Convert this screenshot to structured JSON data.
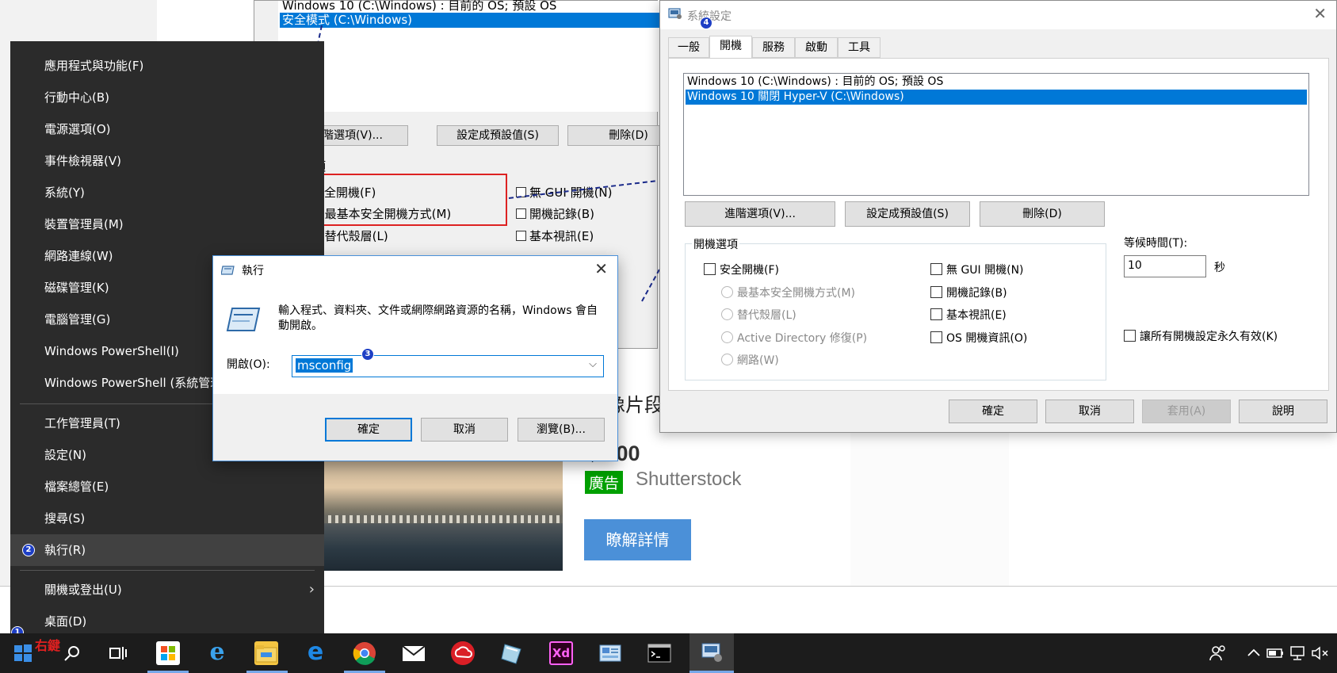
{
  "background": {
    "boot_list": [
      "Windows 10 (C:\\Windows) : 目前的 OS; 預設 OS",
      "安全模式 (C:\\Windows)"
    ],
    "buttons": [
      "進階選項(V)...",
      "設定成預設值(S)",
      "刪除(D)"
    ],
    "opts_label": "項",
    "options_left": [
      "全開機(F)",
      ") 最基本安全開機方式(M)",
      ") 替代殼層(L)"
    ],
    "options_right": [
      "無 GUI 開機(N)",
      "開機記錄(B)",
      "基本視訊(E)"
    ],
    "ad_title_fragment": "像片段",
    "price": "$0.00",
    "ad_badge": "廣告",
    "brand": "Shutterstock",
    "cta": "瞭解詳情"
  },
  "context_menu": {
    "items": [
      "應用程式與功能(F)",
      "行動中心(B)",
      "電源選項(O)",
      "事件檢視器(V)",
      "系統(Y)",
      "裝置管理員(M)",
      "網路連線(W)",
      "磁碟管理(K)",
      "電腦管理(G)",
      "Windows PowerShell(I)",
      "Windows PowerShell (系統管理"
    ],
    "items_2": [
      "工作管理員(T)",
      "設定(N)",
      "檔案總管(E)",
      "搜尋(S)",
      "執行(R)"
    ],
    "items_3": [
      "關機或登出(U)",
      "桌面(D)"
    ],
    "chevron": "chevron-right-icon",
    "badge_run": "2",
    "badge_start": "1",
    "annotation_right_click": "右鍵"
  },
  "run_dialog": {
    "title": "執行",
    "description": "輸入程式、資料夾、文件或網際網路資源的名稱，Windows 會自動開啟。",
    "open_label": "開啟(O):",
    "input_value": "msconfig",
    "badge": "3",
    "buttons": {
      "ok": "確定",
      "cancel": "取消",
      "browse": "瀏覽(B)..."
    }
  },
  "msconfig": {
    "title": "系統設定",
    "badge": "4",
    "tabs": [
      "一般",
      "開機",
      "服務",
      "啟動",
      "工具"
    ],
    "active_tab": "開機",
    "boot_entries": [
      "Windows 10 (C:\\Windows) : 目前的 OS; 預設 OS",
      "Windows 10 關閉 Hyper-V (C:\\Windows)"
    ],
    "selected_entry": 1,
    "buttons": {
      "advanced": "進階選項(V)...",
      "set_default": "設定成預設值(S)",
      "delete": "刪除(D)"
    },
    "boot_options_label": "開機選項",
    "safe_boot": "安全開機(F)",
    "safe_sub": [
      "最基本安全開機方式(M)",
      "替代殼層(L)",
      "Active Directory 修復(P)",
      "網路(W)"
    ],
    "right_opts": [
      "無 GUI 開機(N)",
      "開機記錄(B)",
      "基本視訊(E)",
      "OS 開機資訊(O)"
    ],
    "timeout_label": "等候時間(T):",
    "timeout_value": "10",
    "timeout_unit": "秒",
    "make_permanent": "讓所有開機設定永久有效(K)",
    "footer": {
      "ok": "確定",
      "cancel": "取消",
      "apply": "套用(A)",
      "help": "說明"
    }
  },
  "taskbar": {
    "icons": [
      "windows-start-icon",
      "search-icon",
      "task-view-icon",
      "store-icon",
      "internet-explorer-icon",
      "file-explorer-icon",
      "edge-icon",
      "chrome-icon",
      "mail-icon",
      "creative-cloud-icon",
      "visio-icon",
      "adobe-xd-icon",
      "control-panel-icon",
      "command-prompt-icon",
      "msconfig-icon"
    ],
    "xd_label": "Xd",
    "tray": [
      "people-icon",
      "chevron-up-icon",
      "battery-icon",
      "network-icon",
      "volume-mute-icon"
    ]
  },
  "colors": {
    "accent": "#0078d7",
    "menu_bg": "#2b2b2b",
    "taskbar_bg": "#1c1c1c",
    "badge": "#1e3fc5",
    "annotation_red": "#e02020"
  }
}
